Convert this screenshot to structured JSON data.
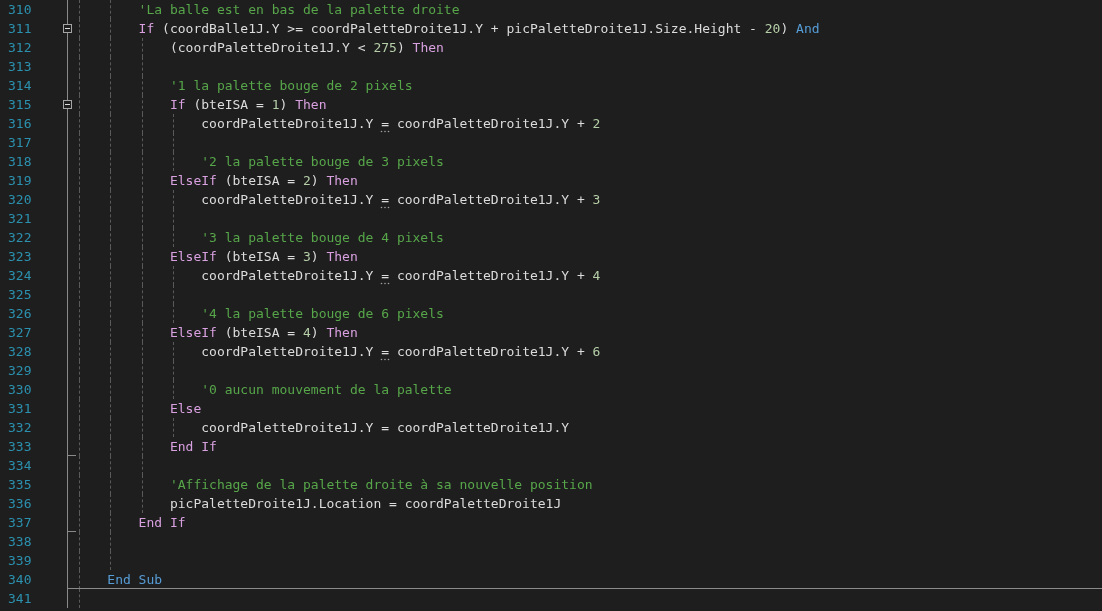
{
  "editor": {
    "lines": [
      {
        "number": "310",
        "segments": [
          {
            "kind": "comment",
            "text": "        'La balle est en bas de la palette droite"
          }
        ]
      },
      {
        "number": "311",
        "fold_start": true,
        "segments": [
          {
            "kind": "control",
            "text": "        If"
          },
          {
            "kind": "plain",
            "text": " (coordBalle1J.Y >= coordPaletteDroite1J.Y + picPaletteDroite1J.Size.Height - "
          },
          {
            "kind": "number",
            "text": "20"
          },
          {
            "kind": "plain",
            "text": ") "
          },
          {
            "kind": "keyword",
            "text": "And"
          }
        ]
      },
      {
        "number": "312",
        "segments": [
          {
            "kind": "plain",
            "text": "            (coordPaletteDroite1J.Y < "
          },
          {
            "kind": "number",
            "text": "275"
          },
          {
            "kind": "plain",
            "text": ") "
          },
          {
            "kind": "control",
            "text": "Then"
          }
        ]
      },
      {
        "number": "313"
      },
      {
        "number": "314",
        "segments": [
          {
            "kind": "comment",
            "text": "            '1 la palette bouge de 2 pixels"
          }
        ]
      },
      {
        "number": "315",
        "fold_start": true,
        "segments": [
          {
            "kind": "control",
            "text": "            If"
          },
          {
            "kind": "plain",
            "text": " (bteISA = "
          },
          {
            "kind": "number",
            "text": "1"
          },
          {
            "kind": "plain",
            "text": ") "
          },
          {
            "kind": "control",
            "text": "Then"
          }
        ]
      },
      {
        "number": "316",
        "segments": [
          {
            "kind": "plain",
            "text": "                coordPaletteDroite1J.Y "
          },
          {
            "kind": "plain",
            "text": "=",
            "suggestion": true
          },
          {
            "kind": "plain",
            "text": " coordPaletteDroite1J.Y + "
          },
          {
            "kind": "number",
            "text": "2"
          }
        ]
      },
      {
        "number": "317"
      },
      {
        "number": "318",
        "segments": [
          {
            "kind": "comment",
            "text": "                '2 la palette bouge de 3 pixels"
          }
        ]
      },
      {
        "number": "319",
        "segments": [
          {
            "kind": "control",
            "text": "            ElseIf"
          },
          {
            "kind": "plain",
            "text": " (bteISA = "
          },
          {
            "kind": "number",
            "text": "2"
          },
          {
            "kind": "plain",
            "text": ") "
          },
          {
            "kind": "control",
            "text": "Then"
          }
        ]
      },
      {
        "number": "320",
        "segments": [
          {
            "kind": "plain",
            "text": "                coordPaletteDroite1J.Y "
          },
          {
            "kind": "plain",
            "text": "=",
            "suggestion": true
          },
          {
            "kind": "plain",
            "text": " coordPaletteDroite1J.Y + "
          },
          {
            "kind": "number",
            "text": "3"
          }
        ]
      },
      {
        "number": "321"
      },
      {
        "number": "322",
        "segments": [
          {
            "kind": "comment",
            "text": "                '3 la palette bouge de 4 pixels"
          }
        ]
      },
      {
        "number": "323",
        "segments": [
          {
            "kind": "control",
            "text": "            ElseIf"
          },
          {
            "kind": "plain",
            "text": " (bteISA = "
          },
          {
            "kind": "number",
            "text": "3"
          },
          {
            "kind": "plain",
            "text": ") "
          },
          {
            "kind": "control",
            "text": "Then"
          }
        ]
      },
      {
        "number": "324",
        "segments": [
          {
            "kind": "plain",
            "text": "                coordPaletteDroite1J.Y "
          },
          {
            "kind": "plain",
            "text": "=",
            "suggestion": true
          },
          {
            "kind": "plain",
            "text": " coordPaletteDroite1J.Y + "
          },
          {
            "kind": "number",
            "text": "4"
          }
        ]
      },
      {
        "number": "325"
      },
      {
        "number": "326",
        "segments": [
          {
            "kind": "comment",
            "text": "                '4 la palette bouge de 6 pixels"
          }
        ]
      },
      {
        "number": "327",
        "segments": [
          {
            "kind": "control",
            "text": "            ElseIf"
          },
          {
            "kind": "plain",
            "text": " (bteISA = "
          },
          {
            "kind": "number",
            "text": "4"
          },
          {
            "kind": "plain",
            "text": ") "
          },
          {
            "kind": "control",
            "text": "Then"
          }
        ]
      },
      {
        "number": "328",
        "segments": [
          {
            "kind": "plain",
            "text": "                coordPaletteDroite1J.Y "
          },
          {
            "kind": "plain",
            "text": "=",
            "suggestion": true
          },
          {
            "kind": "plain",
            "text": " coordPaletteDroite1J.Y + "
          },
          {
            "kind": "number",
            "text": "6"
          }
        ]
      },
      {
        "number": "329"
      },
      {
        "number": "330",
        "segments": [
          {
            "kind": "comment",
            "text": "                '0 aucun mouvement de la palette"
          }
        ]
      },
      {
        "number": "331",
        "segments": [
          {
            "kind": "control",
            "text": "            Else"
          }
        ]
      },
      {
        "number": "332",
        "segments": [
          {
            "kind": "plain",
            "text": "                coordPaletteDroite1J.Y = coordPaletteDroite1J.Y"
          }
        ]
      },
      {
        "number": "333",
        "fold_end": true,
        "segments": [
          {
            "kind": "control",
            "text": "            End If"
          }
        ]
      },
      {
        "number": "334"
      },
      {
        "number": "335",
        "segments": [
          {
            "kind": "comment",
            "text": "            'Affichage de la palette droite à sa nouvelle position"
          }
        ]
      },
      {
        "number": "336",
        "segments": [
          {
            "kind": "plain",
            "text": "            picPaletteDroite1J.Location = coordPaletteDroite1J"
          }
        ]
      },
      {
        "number": "337",
        "fold_end": true,
        "segments": [
          {
            "kind": "control",
            "text": "        End If"
          }
        ]
      },
      {
        "number": "338"
      },
      {
        "number": "339"
      },
      {
        "number": "340",
        "separator_after": true,
        "segments": [
          {
            "kind": "keyword",
            "text": "    End Sub"
          }
        ]
      },
      {
        "number": "341"
      }
    ]
  }
}
